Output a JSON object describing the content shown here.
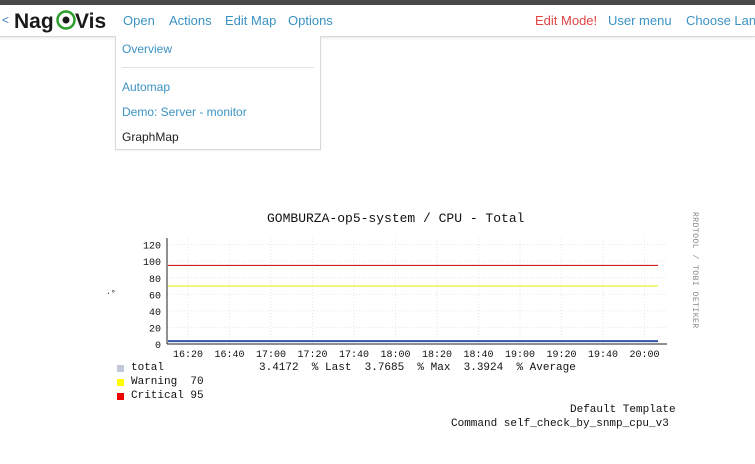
{
  "header": {
    "back_label": "<",
    "logo": {
      "left": "Nag",
      "right": "Vis"
    },
    "menu": {
      "open": "Open",
      "actions": "Actions",
      "edit_map": "Edit Map",
      "options": "Options"
    },
    "right": {
      "edit_mode": "Edit Mode!",
      "user_menu": "User menu",
      "choose_language": "Choose Lan"
    }
  },
  "open_menu": {
    "items": [
      {
        "label": "Overview"
      },
      {
        "label": "Automap"
      },
      {
        "label": "Demo: Server - monitor"
      },
      {
        "label": "GraphMap"
      }
    ]
  },
  "stray_glyph": "·°",
  "graph": {
    "side_label": "RRDTOOL / TOBI OETIKER",
    "legend": {
      "total_label": "total",
      "total_stats": "3.4172  % Last  3.7685  % Max  3.3924  % Average",
      "warning_label": "Warning  70",
      "critical_label": "Critical 95"
    },
    "footer": {
      "template": "Default Template",
      "command": "Command self_check_by_snmp_cpu_v3"
    }
  },
  "chart_data": {
    "type": "line",
    "title": "GOMBURZA-op5-system / CPU - Total",
    "xlabel": "",
    "ylabel": "",
    "x": [
      "16:20",
      "16:40",
      "17:00",
      "17:20",
      "17:40",
      "18:00",
      "18:20",
      "18:40",
      "19:00",
      "19:20",
      "19:40",
      "20:00"
    ],
    "y_ticks": [
      0,
      20,
      40,
      60,
      80,
      100,
      120
    ],
    "ylim": [
      0,
      128
    ],
    "grid": true,
    "legend_position": "bottom-left",
    "series": [
      {
        "name": "total",
        "color": "#3355aa",
        "values": [
          3.4,
          3.4,
          3.4,
          3.4,
          3.4,
          3.4,
          3.4,
          3.4,
          3.4,
          3.4,
          3.4,
          3.4
        ]
      },
      {
        "name": "Warning",
        "color": "#e8e800",
        "values": [
          70,
          70,
          70,
          70,
          70,
          70,
          70,
          70,
          70,
          70,
          70,
          70
        ]
      },
      {
        "name": "Critical",
        "color": "#cc0000",
        "values": [
          95,
          95,
          95,
          95,
          95,
          95,
          95,
          95,
          95,
          95,
          95,
          95
        ]
      }
    ],
    "legend_swatch_colors": {
      "total": "#c2c8d9",
      "warning": "#ffff00",
      "critical": "#ee0000"
    }
  }
}
